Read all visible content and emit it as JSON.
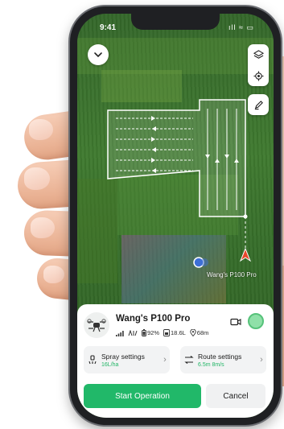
{
  "status_bar": {
    "time": "9:41",
    "icons": "ıll ≈ ▭"
  },
  "drone": {
    "name": "Wang's P100 Pro",
    "map_label": "Wang's P100 Pro",
    "stats": {
      "battery": "92%",
      "tank": "18.6L",
      "altitude": "68m"
    }
  },
  "cards": {
    "spray": {
      "title": "Spray settings",
      "sub": "16L/ha"
    },
    "route": {
      "title": "Route settings",
      "sub": "6.5m  8m/s"
    }
  },
  "actions": {
    "start": "Start Operation",
    "cancel": "Cancel"
  },
  "colors": {
    "accent_green": "#21B869",
    "route_line": "#FFFFFF",
    "drone_marker": "#E8462B",
    "position_dot": "#3E6FD6"
  }
}
